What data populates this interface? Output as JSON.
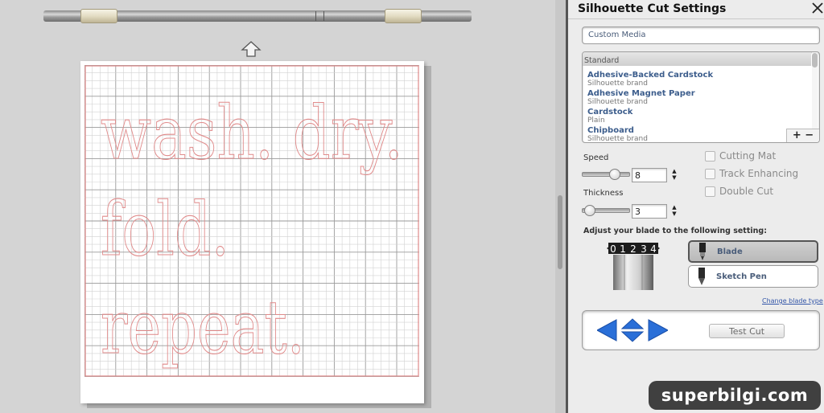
{
  "canvas": {
    "mat_text_lines": [
      "wash. dry.",
      "fold.",
      "repeat."
    ]
  },
  "panel": {
    "title": "Silhouette Cut Settings",
    "media_field": "Custom Media",
    "media_list": {
      "header": "Standard",
      "items": [
        {
          "name": "Adhesive-Backed Cardstock",
          "sub": "Silhouette brand"
        },
        {
          "name": "Adhesive Magnet Paper",
          "sub": "Silhouette brand"
        },
        {
          "name": "Cardstock",
          "sub": "Plain"
        },
        {
          "name": "Chipboard",
          "sub": "Silhouette brand"
        }
      ],
      "add_remove": "+ −"
    },
    "speed": {
      "label": "Speed",
      "value": "8"
    },
    "thickness": {
      "label": "Thickness",
      "value": "3"
    },
    "options": [
      {
        "label": "Cutting Mat",
        "checked": false
      },
      {
        "label": "Track Enhancing",
        "checked": false
      },
      {
        "label": "Double Cut",
        "checked": false
      }
    ],
    "blade_instruction": "Adjust your blade to the following setting:",
    "blade_dial_digits": [
      "0",
      "1",
      "2",
      "3",
      "4"
    ],
    "blade_types": [
      {
        "label": "Blade",
        "selected": true
      },
      {
        "label": "Sketch Pen",
        "selected": false
      }
    ],
    "change_blade_link": "Change blade type",
    "test_cut_label": "Test Cut"
  },
  "watermark": "superbilgi.com",
  "colors": {
    "cut_line": "#e08a8a",
    "grid_major": "#9a9a9a",
    "grid_minor": "#d2d2d2",
    "accent_blue": "#2a6fd8"
  }
}
